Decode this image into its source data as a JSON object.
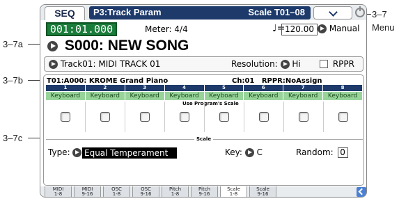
{
  "callouts": {
    "a": "3–7a",
    "b": "3–7b",
    "c": "3–7c",
    "menu_ref": "3–7",
    "menu_word": "Menu"
  },
  "titlebar": {
    "mode": "SEQ",
    "page": "P3:Track Param",
    "scale_track": "Scale T01–08"
  },
  "status": {
    "location": "001:01.000",
    "meter": "Meter: 4/4",
    "tempo_note": "♩=",
    "tempo": "120.00",
    "tempo_mode": "Manual"
  },
  "song": {
    "name": "S000: NEW SONG"
  },
  "track": {
    "label": "Track01: MIDI TRACK 01",
    "resolution_label": "Resolution:",
    "resolution_value": "Hi",
    "rppr_label": "RPPR"
  },
  "program_line": {
    "program": "T01:A000: KROME Grand Piano",
    "channel": "Ch:01",
    "rppr_info": "RPPR:NoAssign"
  },
  "track_columns": [
    "1",
    "2",
    "3",
    "4",
    "5",
    "6",
    "7",
    "8"
  ],
  "scale_types": [
    "Keyboard",
    "Keyboard",
    "Keyboard",
    "Keyboard",
    "Keyboard",
    "Keyboard",
    "Keyboard",
    "Keyboard"
  ],
  "use_programs_scale": "Use Program's Scale",
  "scale_section": "Scale",
  "scale": {
    "type_label": "Type:",
    "type_value": "Equal Temperament",
    "key_label": "Key:",
    "key_value": "C",
    "random_label": "Random:",
    "random_value": "0"
  },
  "tabs": [
    {
      "l1": "MIDI",
      "l2": "1-8"
    },
    {
      "l1": "MIDI",
      "l2": "9-16"
    },
    {
      "l1": "OSC",
      "l2": "1-8"
    },
    {
      "l1": "OSC",
      "l2": "9-16"
    },
    {
      "l1": "Pitch",
      "l2": "1-8"
    },
    {
      "l1": "Pitch",
      "l2": "9-16"
    },
    {
      "l1": "Scale",
      "l2": "1-8"
    },
    {
      "l1": "Scale",
      "l2": "9-16"
    }
  ]
}
